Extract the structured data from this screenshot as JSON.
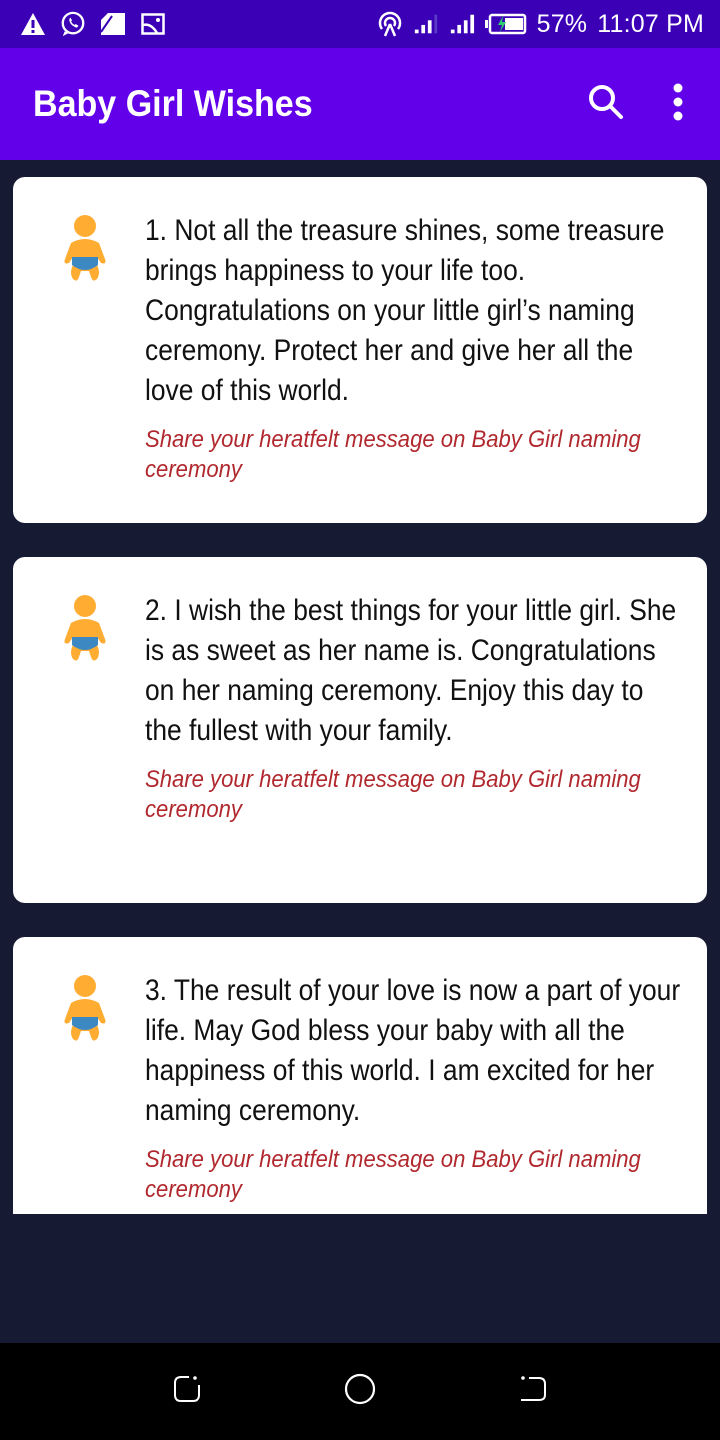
{
  "status_bar": {
    "left_icons": [
      "warning-icon",
      "whatsapp-icon",
      "sim-card-icon",
      "image-icon"
    ],
    "right_icons": [
      "hotspot-icon",
      "signal-icon-1",
      "signal-icon-2",
      "battery-charging-icon"
    ],
    "battery": "57%",
    "time": "11:07 PM"
  },
  "app_bar": {
    "title": "Baby Girl Wishes",
    "actions": [
      "search-icon",
      "more-vert-icon"
    ]
  },
  "wishes": [
    {
      "icon": "baby-icon",
      "text": "1. Not all the treasure shines, some treasure brings happiness to your life too. Congratulations on your little girl’s naming ceremony. Protect her and give her all the love of this world.",
      "subtitle": "Share your heratfelt message on Baby Girl naming ceremony"
    },
    {
      "icon": "baby-icon",
      "text": "2. I wish the best things for your little girl. She is as sweet as her name is. Congratulations on her naming ceremony. Enjoy this day to the fullest with your family.",
      "subtitle": "Share your heratfelt message on Baby Girl naming ceremony"
    },
    {
      "icon": "baby-icon",
      "text": "3. The result of your love is now a part of your life. May God bless your baby with all the happiness of this world. I am excited for her naming ceremony.",
      "subtitle": "Share your heratfelt message on Baby Girl naming ceremony"
    }
  ],
  "nav_bar": {
    "buttons": [
      "recents-button",
      "home-button",
      "back-button"
    ]
  },
  "colors": {
    "status_bar": "#3b00b6",
    "app_bar": "#6200ea",
    "background": "#161a33",
    "subtitle": "#b0282e",
    "baby_skin": "#ffac33",
    "baby_diaper": "#3b88c3"
  }
}
